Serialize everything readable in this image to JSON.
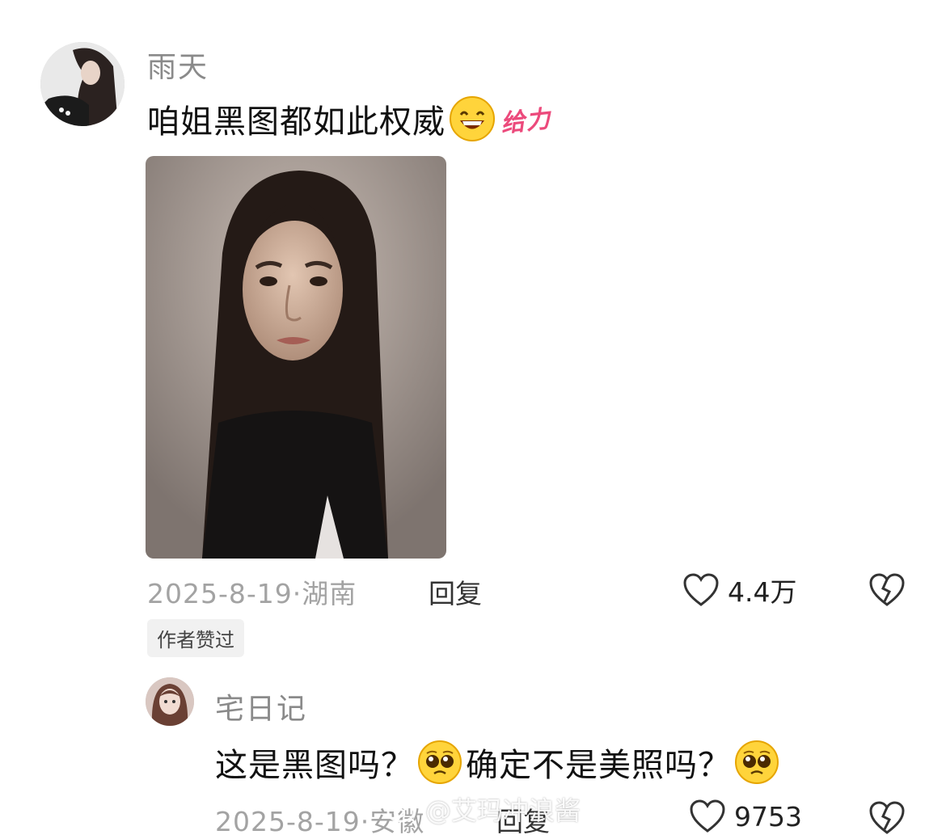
{
  "comment": {
    "username": "雨天",
    "text": "咱姐黑图都如此权威",
    "sticker_text": "给力",
    "date": "2025-8-19",
    "location": "湖南",
    "reply_label": "回复",
    "like_count": "4.4万",
    "author_liked_badge": "作者赞过"
  },
  "reply": {
    "username": "宅日记",
    "text_part1": "这是黑图吗？",
    "text_part2": "确定不是美照吗？",
    "date": "2025-8-19",
    "location": "安徽",
    "reply_label": "回复",
    "like_count": "9753"
  },
  "watermark": {
    "text": "@艾玛冲浪酱"
  },
  "colors": {
    "username": "#8a8a8a",
    "meta": "#a3a3a3",
    "sticker": "#ec4a7c",
    "badge_bg": "#f1f1f1"
  }
}
